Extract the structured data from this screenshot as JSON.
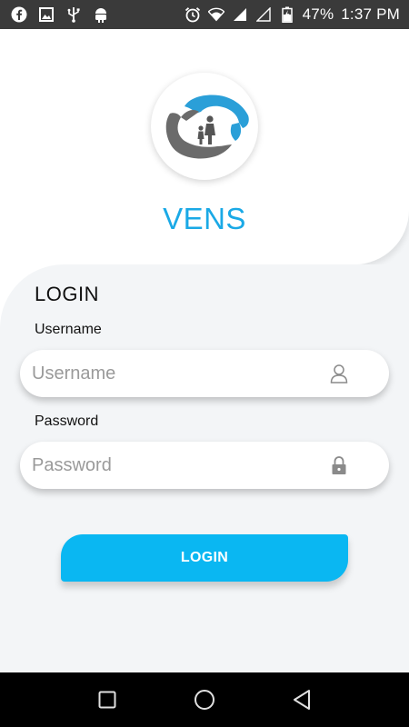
{
  "status_bar": {
    "battery_percent": "47%",
    "time": "1:37 PM",
    "left_icons": [
      "facebook-icon",
      "image-icon",
      "usb-icon",
      "android-icon"
    ],
    "right_icons": [
      "alarm-icon",
      "wifi-icon",
      "signal-icon",
      "signal-empty-icon",
      "battery-icon"
    ]
  },
  "app": {
    "title": "VENS",
    "logo_icon": "family-hands-logo"
  },
  "login": {
    "heading": "LOGIN",
    "username_label": "Username",
    "username_placeholder": "Username",
    "username_value": "",
    "password_label": "Password",
    "password_placeholder": "Password",
    "password_value": "",
    "button_label": "LOGIN",
    "user_icon": "user-icon",
    "lock_icon": "lock-icon"
  },
  "nav_bar": {
    "buttons": [
      "recents-square-icon",
      "home-circle-icon",
      "back-triangle-icon"
    ]
  },
  "colors": {
    "accent": "#1aa9e6",
    "button": "#0ab7f2",
    "status_bar": "#3a3a3a",
    "panel": "#f3f5f7",
    "nav_bar": "#000000"
  }
}
